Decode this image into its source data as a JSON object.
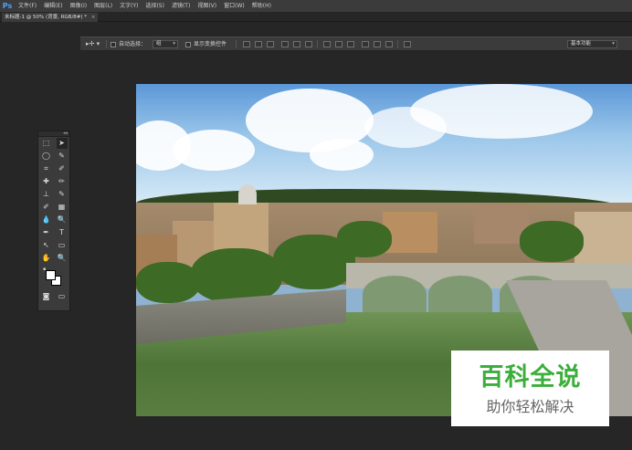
{
  "app": {
    "logo": "Ps"
  },
  "menu": [
    "文件(F)",
    "编辑(E)",
    "图像(I)",
    "图层(L)",
    "文字(Y)",
    "选择(S)",
    "滤镜(T)",
    "视图(V)",
    "窗口(W)",
    "帮助(H)"
  ],
  "document_tab": {
    "title": "未标题-1 @ 50% (背景, RGB/8#) *",
    "close": "×"
  },
  "options_bar": {
    "auto_select_label": "自动选择：",
    "auto_select_value": "组",
    "show_transform_label": "显示变换控件",
    "workspace_value": "基本功能"
  },
  "toolbox": {
    "collapse": "◂◂",
    "tools": [
      [
        "⬚",
        "➤"
      ],
      [
        "◯",
        "✎"
      ],
      [
        "⌗",
        "✐"
      ],
      [
        "✚",
        "✏"
      ],
      [
        "⊥",
        "✎"
      ],
      [
        "✐",
        "▦"
      ],
      [
        "💧",
        "🔍"
      ],
      [
        "✒",
        "T"
      ],
      [
        "↖",
        "▭"
      ],
      [
        "✋",
        "🔍"
      ]
    ]
  },
  "watermark": {
    "title": "百科全说",
    "subtitle": "助你轻松解决"
  },
  "colors": {
    "accent": "#4aa3ff",
    "watermark_green": "#3cae3c"
  }
}
